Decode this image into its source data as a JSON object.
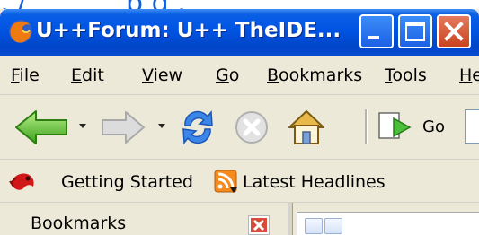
{
  "window": {
    "title": "U++Forum: U++ TheIDE..."
  },
  "menubar": {
    "items": [
      {
        "label_first": "F",
        "label_rest": "ile"
      },
      {
        "label_first": "E",
        "label_rest": "dit"
      },
      {
        "label_first": "V",
        "label_rest": "iew"
      },
      {
        "label_first": "G",
        "label_rest": "o"
      },
      {
        "label_first": "B",
        "label_rest": "ookmarks"
      },
      {
        "label_first": "T",
        "label_rest": "ools"
      },
      {
        "label_first": "H",
        "label_rest": "e"
      }
    ]
  },
  "navbar": {
    "go_label": "Go",
    "icons": [
      "back-icon",
      "forward-icon",
      "reload-icon",
      "stop-icon",
      "home-icon",
      "go-icon"
    ]
  },
  "bookmarks_toolbar": {
    "items": [
      {
        "label": "Getting Started",
        "icon": "firefox-icon"
      },
      {
        "label": "Latest Headlines",
        "icon": "rss-icon"
      }
    ]
  },
  "sidebar": {
    "title": "Bookmarks"
  },
  "colors": {
    "titlebar": "#0054e3",
    "chrome": "#ece9d8",
    "close_button": "#c9431f"
  }
}
